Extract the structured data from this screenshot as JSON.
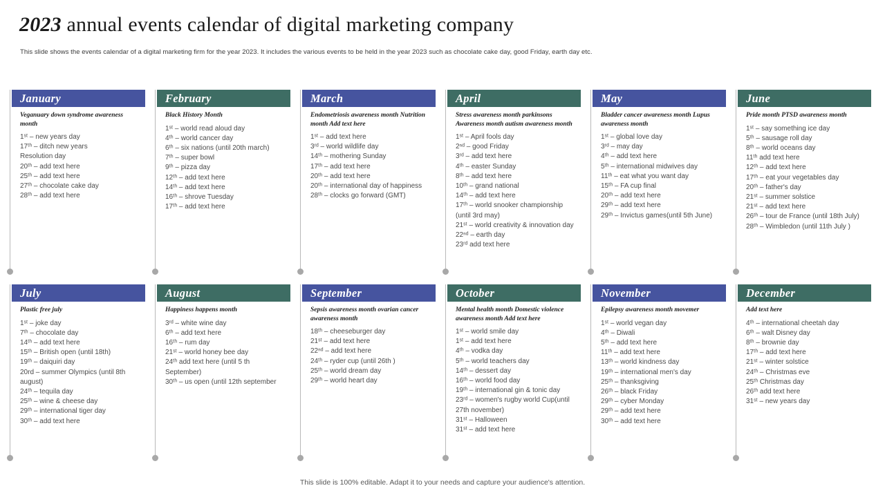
{
  "slide": {
    "title_year": "2023",
    "title_rest": " annual events calendar of digital marketing company",
    "subtitle": "This slide shows the events calendar of a digital marketing firm for the year 2023. It includes the various events to be held in the year 2023 such as chocolate cake day,  good Friday,  earth day etc.",
    "footer": "This slide is 100% editable. Adapt it to your needs and capture your audience's attention."
  },
  "colors": {
    "header_blue": "#46549f",
    "header_green": "#3e6d64",
    "rail_gray": "#b8b8b8",
    "dot_gray": "#a8a8a8",
    "body_text": "#4a4a4a",
    "theme_text": "#1f1f1f"
  },
  "months": [
    {
      "name": "January",
      "accent": "blue",
      "theme": "Veganuary down  syndrome awareness month",
      "events": [
        "1ˢᵗ – new years day",
        "17ᵗʰ – ditch new years",
        "Resolution day",
        "20ᵗʰ – add text here",
        "25ᵗʰ – add text here",
        "27ᵗʰ – chocolate cake day",
        "28ᵗʰ – add text here"
      ]
    },
    {
      "name": "February",
      "accent": "green",
      "theme": "Black History Month",
      "events": [
        "1ˢᵗ – world read aloud day",
        "4ᵗʰ – world cancer day",
        "6ᵗʰ – six nations (until 20th march)",
        "7ᵗʰ  – super bowl",
        "9ᵗʰ – pizza day",
        "12ᵗʰ – add text here",
        "14ᵗʰ – add text here",
        "16ᵗʰ – shrove Tuesday",
        "17ᵗʰ – add text here"
      ]
    },
    {
      "name": "March",
      "accent": "blue",
      "theme": "Endometriosis awareness month Nutrition month Add  text here",
      "events": [
        "1ˢᵗ – add text here",
        "3ʳᵈ – world wildlife day",
        "14ᵗʰ – mothering Sunday",
        "17ᵗʰ – add text here",
        "20ᵗʰ – add text here",
        "20ᵗʰ – international day of happiness",
        "28ᵗʰ – clocks go forward (GMT)"
      ]
    },
    {
      "name": "April",
      "accent": "green",
      "theme": "Stress awareness month parkinsons Awareness month autism awareness month",
      "events": [
        "1ˢᵗ – April fools day",
        "2ⁿᵈ – good Friday",
        "3ʳᵈ – add text here",
        "4ᵗʰ – easter Sunday",
        "8ᵗʰ – add text here",
        "10ᵗʰ – grand national",
        "14ᵗʰ – add text here",
        "17ᵗʰ – world snooker championship (until 3rd may)",
        "21ˢᵗ – world creativity & innovation day",
        "22ⁿᵈ – earth day",
        "23ʳᵈ add text here"
      ]
    },
    {
      "name": "May",
      "accent": "blue",
      "theme": "Bladder cancer awareness month Lupus awareness month",
      "events": [
        "1ˢᵗ – global love day",
        "3ʳᵈ – may day",
        "4ᵗʰ – add text here",
        "5ᵗʰ – international midwives day",
        "11ᵗʰ – eat what you want day",
        "15ᵗʰ – FA  cup final",
        "20ᵗʰ – add text here",
        "29ᵗʰ – add text here",
        "29ᵗʰ – Invictus games(until 5th June)"
      ]
    },
    {
      "name": "June",
      "accent": "green",
      "theme": "Pride month  PTSD awareness month",
      "events": [
        "1ˢᵗ – say something ice day",
        "5ᵗʰ – sausage roll day",
        "8ᵗʰ – world oceans day",
        "11ᵗʰ add text here",
        "12ᵗʰ – add text here",
        "17ᵗʰ – eat your vegetables day",
        "20ᵗʰ – father's day",
        "21ˢᵗ – summer solstice",
        "21ˢᵗ – add text here",
        "26ᵗʰ – tour de France (until 18th July)",
        "28ᵗʰ – Wimbledon (until 11th July )"
      ]
    },
    {
      "name": "July",
      "accent": "blue",
      "theme": "Plastic free july",
      "events": [
        "1ˢᵗ – joke day",
        "7ᵗʰ – chocolate day",
        "14ᵗʰ – add text here",
        "15ᵗʰ – British open (until 18th)",
        "19ᵗʰ – daiquiri day",
        "20rd – summer Olympics (until 8th august)",
        "24ᵗʰ – tequila day",
        "25ᵗʰ – wine & cheese day",
        "29ᵗʰ – international tiger day",
        "30ᵗʰ – add text here"
      ]
    },
    {
      "name": "August",
      "accent": "green",
      "theme": "Happiness happens month",
      "events": [
        "3ʳᵈ – white wine day",
        "6ᵗʰ – add text here",
        "16ᵗʰ – rum day",
        "21ˢᵗ – world honey bee day",
        "24ᵗʰ add text here (until 5 th September)",
        "30ᵗʰ – us open (until 12th september"
      ]
    },
    {
      "name": "September",
      "accent": "blue",
      "theme": "Sepsis awareness month ovarian cancer awareness month",
      "events": [
        "18ᵗʰ – cheeseburger day",
        "21ˢᵗ – add text here",
        "22ⁿᵈ – add text here",
        "24ᵗʰ – ryder cup (until 26th )",
        "25ᵗʰ – world dream day",
        "29ᵗʰ – world heart day"
      ]
    },
    {
      "name": "October",
      "accent": "green",
      "theme": "Mental health month Domestic violence awareness month Add  text here",
      "events": [
        "1ˢᵗ – world smile day",
        "1ˢᵗ – add text here",
        "4ᵗʰ – vodka day",
        "5ᵗʰ – world teachers day",
        "14ᵗʰ – dessert day",
        "16ᵗʰ – world food day",
        "19ᵗʰ – international gin & tonic day",
        "23ʳᵈ – women's rugby world Cup(until 27th november)",
        "31ˢᵗ – Halloween",
        "31ˢᵗ – add text here"
      ]
    },
    {
      "name": "November",
      "accent": "blue",
      "theme": "Epilepsy awareness month movemer",
      "events": [
        "1ˢᵗ –  world vegan day",
        "4ᵗʰ  – Diwali",
        "5ᵗʰ – add text here",
        "11ᵗʰ – add text here",
        "13ᵗʰ – world kindness day",
        "19ᵗʰ – international men's day",
        "25ᵗʰ – thanksgiving",
        "26ᵗʰ – black Friday",
        "29ᵗʰ – cyber Monday",
        "29ᵗʰ – add text here",
        "30ᵗʰ – add text here"
      ]
    },
    {
      "name": "December",
      "accent": "green",
      "theme": "Add  text here",
      "events": [
        "4ᵗʰ – international cheetah day",
        "6ᵗʰ – walt Disney day",
        "8ᵗʰ – brownie day",
        "17ᵗʰ – add text here",
        "21ˢᵗ – winter solstice",
        "24ᵗʰ – Christmas eve",
        "25ᵗʰ Christmas day",
        "26ᵗʰ add text here",
        "31ˢᵗ – new years day"
      ]
    }
  ]
}
